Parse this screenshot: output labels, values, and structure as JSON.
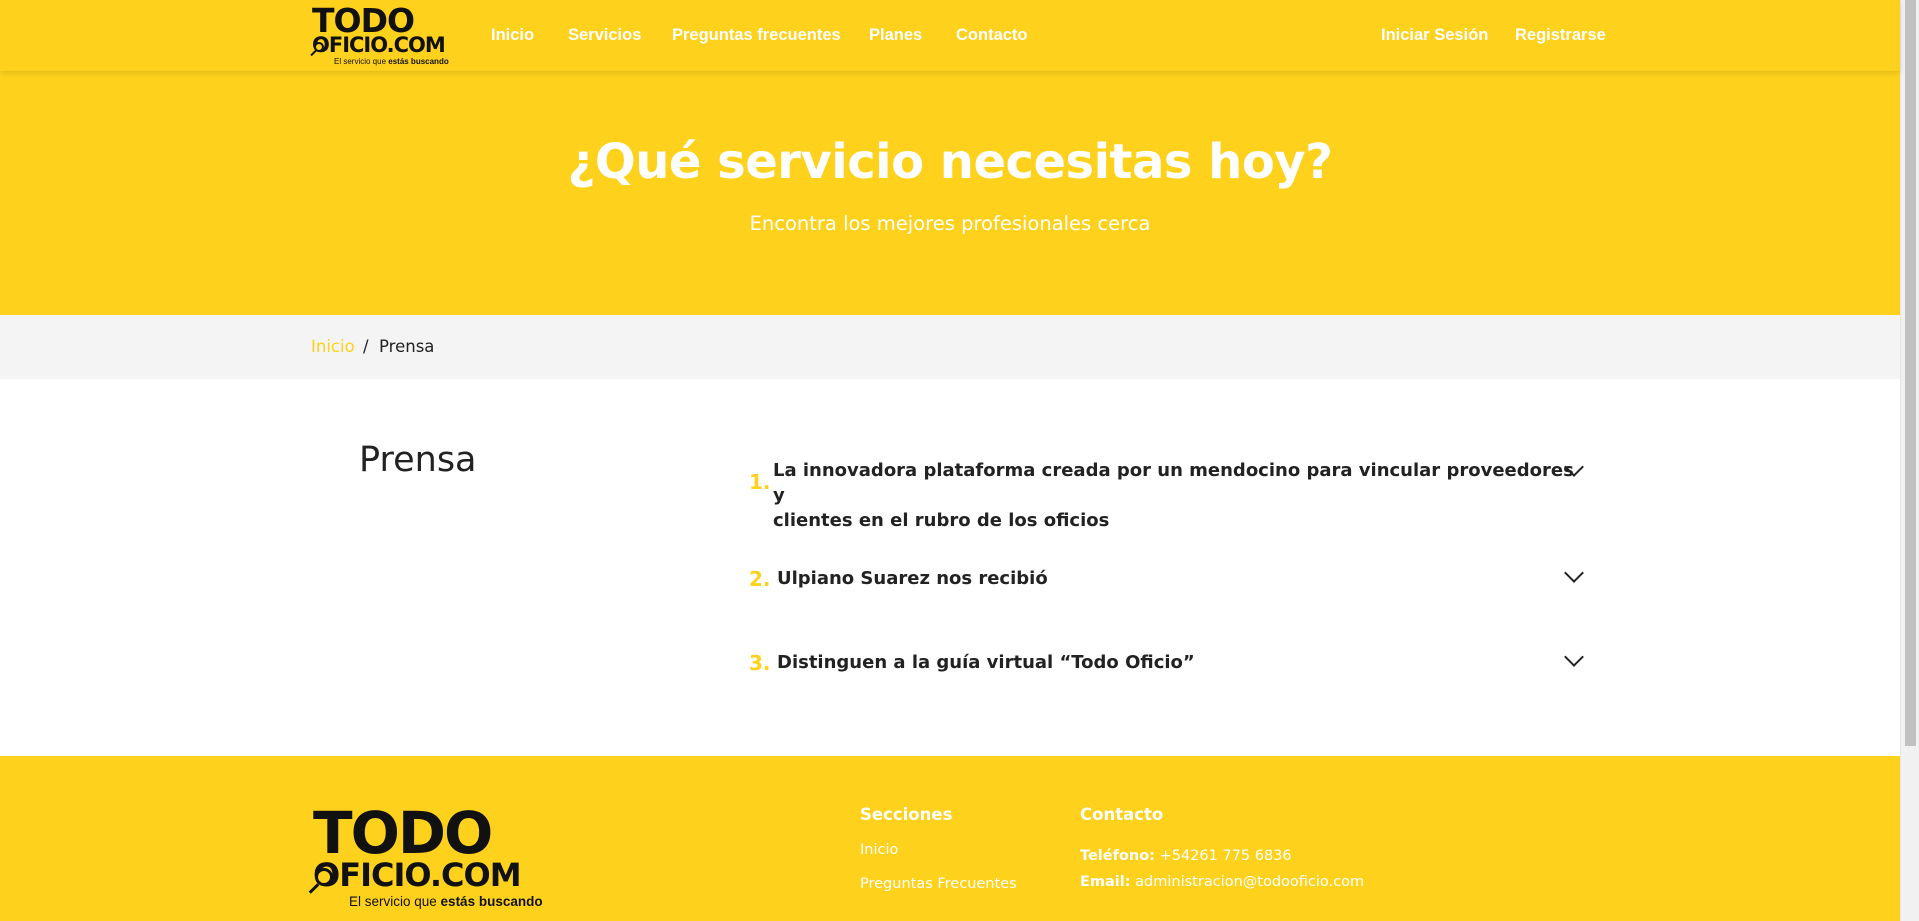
{
  "brand": {
    "logo_line1": "TODO",
    "logo_line2": "OFICIO.COM",
    "tagline_prefix": "El servicio que ",
    "tagline_emphasis": "estás buscando"
  },
  "nav": {
    "items": [
      "Inicio",
      "Servicios",
      "Preguntas frecuentes",
      "Planes",
      "Contacto"
    ],
    "login": "Iniciar Sesión",
    "register": "Registrarse"
  },
  "hero": {
    "title": "¿Qué servicio necesitas hoy?",
    "subtitle": "Encontra los mejores profesionales cerca"
  },
  "breadcrumb": {
    "home": "Inicio",
    "separator": "/",
    "current": "Prensa"
  },
  "main": {
    "section_title": "Prensa",
    "items": [
      {
        "number": "1.",
        "line1": "La innovadora plataforma creada por un mendocino para vincular proveedores y",
        "line2": "clientes en el rubro de los oficios"
      },
      {
        "number": "2.",
        "line1": "Ulpiano Suarez nos recibió"
      },
      {
        "number": "3.",
        "line1": "Distinguen a la guía virtual “Todo Oficio”"
      }
    ]
  },
  "footer": {
    "sections_title": "Secciones",
    "sections_links": [
      "Inicio",
      "Preguntas Frecuentes"
    ],
    "contact_title": "Contacto",
    "phone_label": "Teléfono:",
    "phone_value": " +54261 775 6836",
    "email_label": "Email:",
    "email_value": " administracion@todooficio.com"
  },
  "colors": {
    "brand_yellow": "#fed21c",
    "text_dark": "#222222",
    "breadcrumb_bg": "#f4f4f4"
  }
}
